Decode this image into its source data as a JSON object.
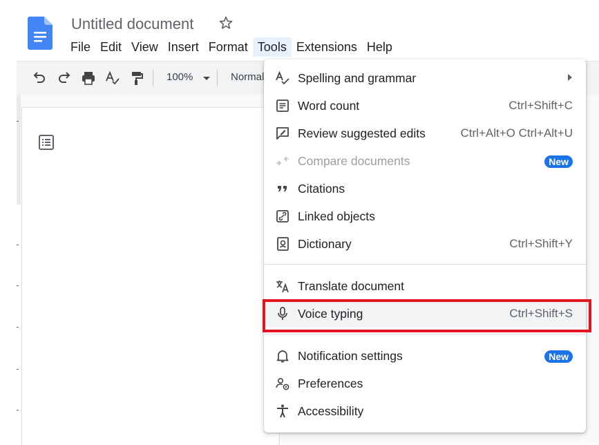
{
  "header": {
    "title": "Untitled document",
    "menus": [
      {
        "label": "File"
      },
      {
        "label": "Edit"
      },
      {
        "label": "View"
      },
      {
        "label": "Insert"
      },
      {
        "label": "Format"
      },
      {
        "label": "Tools",
        "active": true
      },
      {
        "label": "Extensions"
      },
      {
        "label": "Help"
      }
    ]
  },
  "toolbar": {
    "zoom": "100%",
    "style": "Normal"
  },
  "tools_menu": {
    "items": [
      {
        "label": "Spelling and grammar",
        "shortcut": "",
        "icon": "spellcheck-icon",
        "submenu": true
      },
      {
        "label": "Word count",
        "shortcut": "Ctrl+Shift+C",
        "icon": "word-count-icon"
      },
      {
        "label": "Review suggested edits",
        "shortcut": "Ctrl+Alt+O Ctrl+Alt+U",
        "icon": "review-edits-icon"
      },
      {
        "label": "Compare documents",
        "badge": "New",
        "icon": "compare-icon",
        "disabled": true
      },
      {
        "label": "Citations",
        "shortcut": "",
        "icon": "quote-icon"
      },
      {
        "label": "Linked objects",
        "shortcut": "",
        "icon": "link-icon"
      },
      {
        "label": "Dictionary",
        "shortcut": "Ctrl+Shift+Y",
        "icon": "dictionary-icon"
      },
      {
        "label": "Translate document",
        "shortcut": "",
        "icon": "translate-icon"
      },
      {
        "label": "Voice typing",
        "shortcut": "Ctrl+Shift+S",
        "icon": "microphone-icon",
        "highlighted": true
      },
      {
        "label": "Notification settings",
        "badge": "New",
        "icon": "bell-icon"
      },
      {
        "label": "Preferences",
        "shortcut": "",
        "icon": "preferences-icon"
      },
      {
        "label": "Accessibility",
        "shortcut": "",
        "icon": "accessibility-icon"
      }
    ]
  },
  "colors": {
    "accent": "#1a73e8",
    "highlight_border": "#e3141e",
    "doc_blue": "#4285f4"
  }
}
